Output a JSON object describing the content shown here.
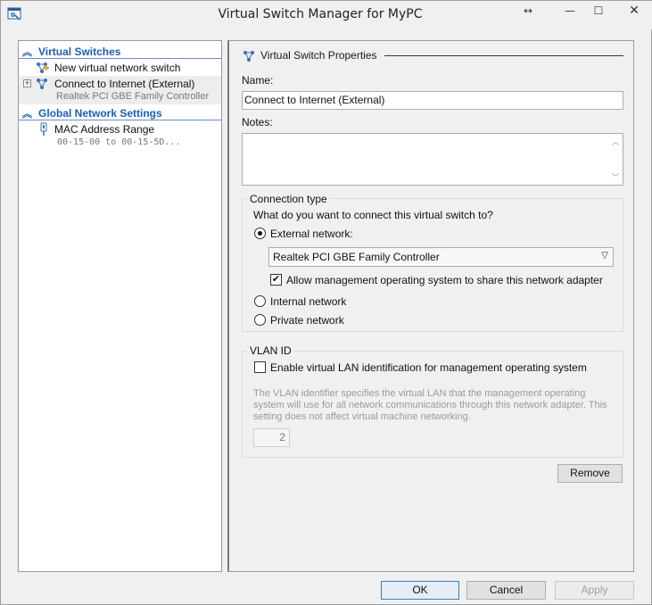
{
  "window": {
    "title": "Virtual Switch Manager for MyPC",
    "controls": {
      "resize": "↔",
      "minimize": "—",
      "maximize": "☐",
      "close": "✕"
    }
  },
  "left_pane": {
    "virtual_switches_heading": "Virtual Switches",
    "new_switch_label": "New virtual network switch",
    "switch_name": "Connect to Internet (External)",
    "switch_adapter": "Realtek PCI GBE Family Controller",
    "global_heading": "Global Network Settings",
    "mac_label": "MAC Address Range",
    "mac_value": "00-15-00 to 00-15-5D..."
  },
  "properties": {
    "heading": "Virtual Switch Properties",
    "name_label": "Name:",
    "name_value": "Connect to Internet (External)",
    "notes_label": "Notes:",
    "notes_value": ""
  },
  "connection_type": {
    "title": "Connection type",
    "question": "What do you want to connect this virtual switch to?",
    "external_label": "External network:",
    "adapter_selected": "Realtek PCI GBE Family Controller",
    "allow_mgmt_label": "Allow management operating system to share this network adapter",
    "internal_label": "Internal network",
    "private_label": "Private network",
    "selected": "external"
  },
  "vlan": {
    "title": "VLAN ID",
    "enable_label": "Enable virtual LAN identification for management operating system",
    "description": "The VLAN identifier specifies the virtual LAN that the management operating system will use for all network communications through this network adapter. This setting does not affect virtual machine networking.",
    "vlan_value": "2"
  },
  "buttons": {
    "remove": "Remove",
    "ok": "OK",
    "cancel": "Cancel",
    "apply": "Apply"
  },
  "colors": {
    "section_heading": "#1a5fb4",
    "window_bg": "#f0f0f0",
    "default_button_border": "#3c7fb1"
  }
}
